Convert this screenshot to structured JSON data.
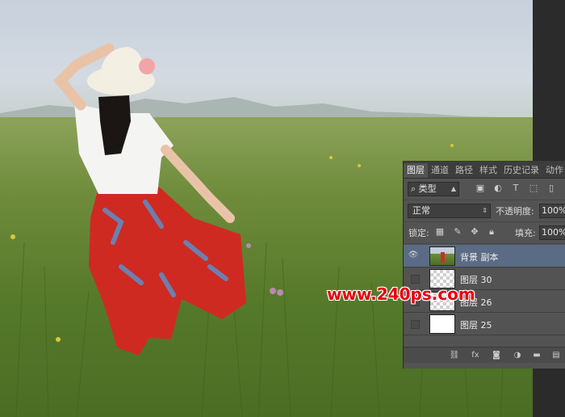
{
  "panel": {
    "tabs": [
      "图层",
      "通道",
      "路径",
      "样式",
      "历史记录",
      "动作"
    ],
    "filter": {
      "kind_label": "类型"
    },
    "blend": {
      "mode": "正常",
      "opacity_label": "不透明度:",
      "opacity_value": "100%"
    },
    "lock": {
      "label": "锁定:",
      "fill_label": "填充:",
      "fill_value": "100%"
    },
    "layers": [
      {
        "name": "背景 副本",
        "visible": true,
        "selected": true,
        "thumb": "photo"
      },
      {
        "name": "图层 30",
        "visible": false,
        "selected": false,
        "thumb": "checker"
      },
      {
        "name": "图层 26",
        "visible": false,
        "selected": false,
        "thumb": "checker"
      },
      {
        "name": "图层 25",
        "visible": false,
        "selected": false,
        "thumb": "white"
      }
    ]
  },
  "watermark": "www.240ps.com",
  "icons": {
    "filter_icons": [
      "image-icon",
      "adjustment-icon",
      "type-icon",
      "shape-icon",
      "smart-object-icon"
    ],
    "lock_icons": [
      "lock-transparent-icon",
      "lock-paint-icon",
      "lock-position-icon",
      "lock-all-icon"
    ],
    "footer_icons": [
      "link-icon",
      "fx-icon",
      "mask-icon",
      "adjustment-layer-icon",
      "group-icon",
      "new-layer-icon"
    ]
  }
}
